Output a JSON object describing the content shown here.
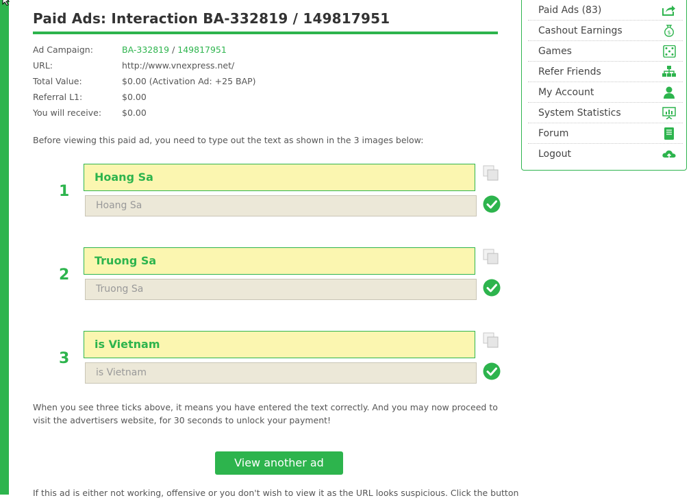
{
  "page": {
    "title": "Paid Ads: Interaction BA-332819 / 149817951"
  },
  "info": {
    "ad_campaign_label": "Ad Campaign:",
    "ad_campaign_id": "BA-332819",
    "ad_campaign_sep": " / ",
    "ad_campaign_num": "149817951",
    "url_label": "URL:",
    "url_value": "http://www.vnexpress.net/",
    "total_label": "Total Value:",
    "total_value": "$0.00 (Activation Ad: +25 BAP)",
    "referral_label": "Referral L1:",
    "referral_value": "$0.00",
    "receive_label": "You will receive:",
    "receive_value": "$0.00"
  },
  "instructions": "Before viewing this paid ad, you need to type out the text as shown in the 3 images below:",
  "captchas": [
    {
      "number": "1",
      "image_text": "Hoang Sa",
      "input_value": "Hoang Sa"
    },
    {
      "number": "2",
      "image_text": "Truong Sa",
      "input_value": "Truong Sa"
    },
    {
      "number": "3",
      "image_text": "is Vietnam",
      "input_value": "is Vietnam"
    }
  ],
  "notice": "When you see three ticks above, it means you have entered the text correctly. And you may now proceed to visit the advertisers website, for 30 seconds to unlock your payment!",
  "view_button_label": "View another ad",
  "bottom_text": "If this ad is either not working, offensive or you don't wish to view it as the URL looks suspicious. Click the button",
  "sidebar": {
    "items": [
      {
        "label": "Paid Ads (83)",
        "icon": "share-icon"
      },
      {
        "label": "Cashout Earnings",
        "icon": "money-bag-icon"
      },
      {
        "label": "Games",
        "icon": "dice-icon"
      },
      {
        "label": "Refer Friends",
        "icon": "sitemap-icon"
      },
      {
        "label": "My Account",
        "icon": "user-icon"
      },
      {
        "label": "System Statistics",
        "icon": "presentation-icon"
      },
      {
        "label": "Forum",
        "icon": "book-icon"
      },
      {
        "label": "Logout",
        "icon": "cloud-upload-icon"
      }
    ]
  },
  "colors": {
    "accent": "#2db44d",
    "captcha_bg": "#fbf6b0",
    "input_bg": "#ece8d8"
  }
}
